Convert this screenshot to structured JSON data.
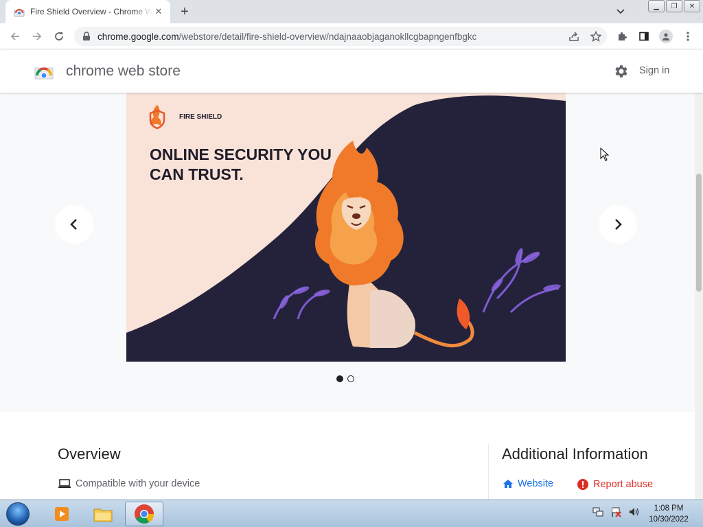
{
  "browser": {
    "tab_title": "Fire Shield Overview - Chrome Web Store",
    "url_host": "chrome.google.com",
    "url_path": "/webstore/detail/fire-shield-overview/ndajnaaobjaganokllcgbapngenfbgkc"
  },
  "store": {
    "title": "chrome web store",
    "signin": "Sign in"
  },
  "slide": {
    "brand": "FIRE SHIELD",
    "headline_line1": "ONLINE SECURITY YOU",
    "headline_line2": "CAN TRUST.",
    "current": 1,
    "total": 2
  },
  "overview": {
    "title": "Overview",
    "compat": "Compatible with your device"
  },
  "additional": {
    "title": "Additional Information",
    "website": "Website",
    "report": "Report abuse"
  },
  "taskbar": {
    "time": "1:08 PM",
    "date": "10/30/2022"
  },
  "colors": {
    "accent_blue": "#1a73e8",
    "report_red": "#d93025",
    "slide_bg": "#f9e2d8",
    "slide_dark": "#24223a",
    "lion_orange": "#f07a2a"
  }
}
